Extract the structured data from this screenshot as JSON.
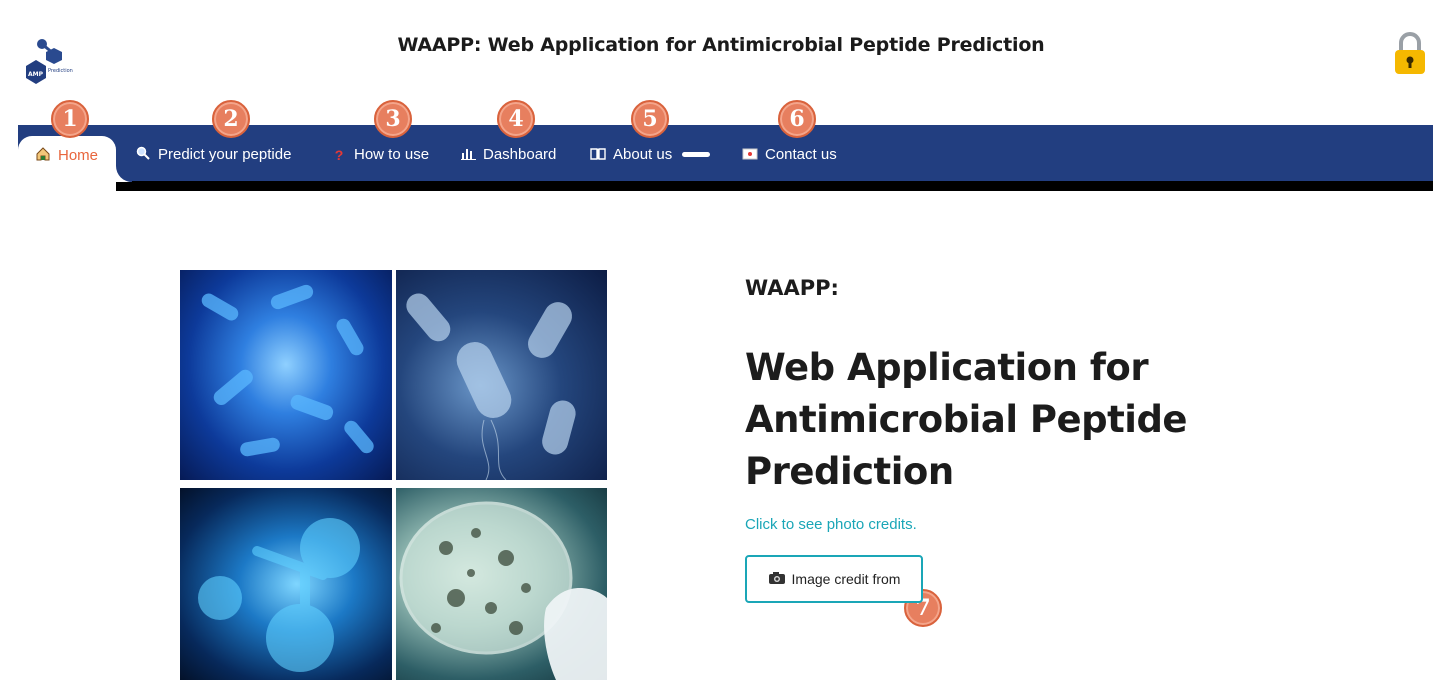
{
  "header": {
    "title": "WAAPP: Web Application for Antimicrobial Peptide Prediction",
    "logo_text_left": "AMP",
    "logo_text_right": "Prediction"
  },
  "nav": {
    "items": [
      {
        "label": "Home",
        "icon": "house-icon",
        "active": true
      },
      {
        "label": "Predict your peptide",
        "icon": "magnifier-icon"
      },
      {
        "label": "How to use",
        "icon": "question-icon"
      },
      {
        "label": "Dashboard",
        "icon": "bar-chart-icon"
      },
      {
        "label": "About us",
        "icon": "book-icon"
      },
      {
        "label": "Contact us",
        "icon": "envelope-icon"
      }
    ]
  },
  "badges": [
    "1",
    "2",
    "3",
    "4",
    "5",
    "6",
    "7"
  ],
  "main": {
    "label": "WAAPP:",
    "headline_line1": "Web Application for",
    "headline_line2": "Antimicrobial Peptide",
    "headline_line3": "Prediction",
    "credits_link": "Click to see photo credits.",
    "credit_button": "Image credit from"
  },
  "colors": {
    "navbar": "#223e80",
    "active_tab_text": "#e8663d",
    "accent_teal": "#1aa6b7",
    "badge": "#e77f5f",
    "lock": "#f5b800"
  }
}
